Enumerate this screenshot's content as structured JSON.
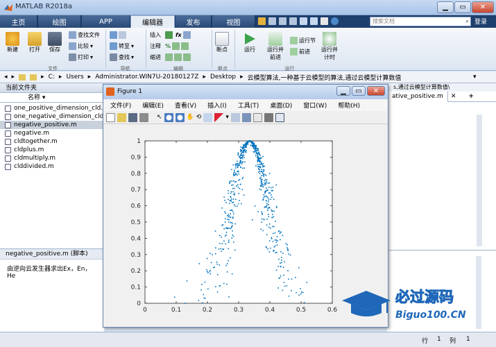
{
  "window": {
    "title": "MATLAB R2018a"
  },
  "tabs": [
    {
      "label": "主页"
    },
    {
      "label": "绘图"
    },
    {
      "label": "APP"
    },
    {
      "label": "编辑器"
    },
    {
      "label": "发布"
    },
    {
      "label": "视图"
    }
  ],
  "search": {
    "placeholder": "搜索文档"
  },
  "login": "登录",
  "ribbon": {
    "file": {
      "new": "新建",
      "open": "打开",
      "save": "保存",
      "find_files": "查找文件",
      "compare": "比较",
      "print": "打印",
      "group": "文件"
    },
    "nav": {
      "goto": "转至",
      "find": "查找",
      "group": "导航"
    },
    "edit": {
      "insert": "插入",
      "comment": "注释",
      "indent": "缩进",
      "group": "编辑"
    },
    "breakpoints": {
      "label": "断点",
      "group": "断点"
    },
    "run": {
      "run": "运行",
      "run_advance_1": "运行并",
      "run_advance_2": "前进",
      "run_section": "运行节",
      "advance": "前进",
      "run_time_1": "运行并",
      "run_time_2": "计时",
      "group": "运行"
    }
  },
  "address": {
    "parts": [
      "C:",
      "Users",
      "Administrator.WIN7U-20180127Z",
      "Desktop",
      "云模型算法,一种基于云模型的算法,通过云模型计算数值"
    ]
  },
  "current_folder": {
    "title": "当前文件夹",
    "column": "名称",
    "files": [
      {
        "name": "one_positive_dimension_cld.m"
      },
      {
        "name": "one_negative_dimension_cld.m"
      },
      {
        "name": "negative_positive.m"
      },
      {
        "name": "negative.m"
      },
      {
        "name": "cldtogether.m"
      },
      {
        "name": "cldplus.m"
      },
      {
        "name": "cldmultiply.m"
      },
      {
        "name": "clddivided.m"
      }
    ]
  },
  "details": {
    "header": "negative_positive.m  (脚本)",
    "body": "由逆向云发生器求出Ex，En，He"
  },
  "editor": {
    "path": "s,通过云模型计算数值\\",
    "tab": "ative_positive.m"
  },
  "status": {
    "line_label": "行",
    "line": "1",
    "col_label": "列",
    "col": "1"
  },
  "figure": {
    "title": "Figure 1",
    "menu": [
      "文件(F)",
      "编辑(E)",
      "查看(V)",
      "插入(I)",
      "工具(T)",
      "桌面(D)",
      "窗口(W)",
      "帮助(H)"
    ]
  },
  "chart_data": {
    "type": "scatter",
    "title": "",
    "xlabel": "",
    "ylabel": "",
    "xlim": [
      0,
      0.6
    ],
    "ylim": [
      0,
      1
    ],
    "xticks": [
      "0",
      "0.1",
      "0.2",
      "0.3",
      "0.4",
      "0.5",
      "0.6"
    ],
    "yticks": [
      "0",
      "0.1",
      "0.2",
      "0.3",
      "0.4",
      "0.5",
      "0.6",
      "0.7",
      "0.8",
      "0.9",
      "1"
    ],
    "color": "#0072bd",
    "series": [
      {
        "Ex": 0.335,
        "En": 0.06,
        "He": 0.015,
        "n": 700
      }
    ]
  },
  "watermark": {
    "brand": "必过源码",
    "domain": "Biguo100.CN"
  }
}
